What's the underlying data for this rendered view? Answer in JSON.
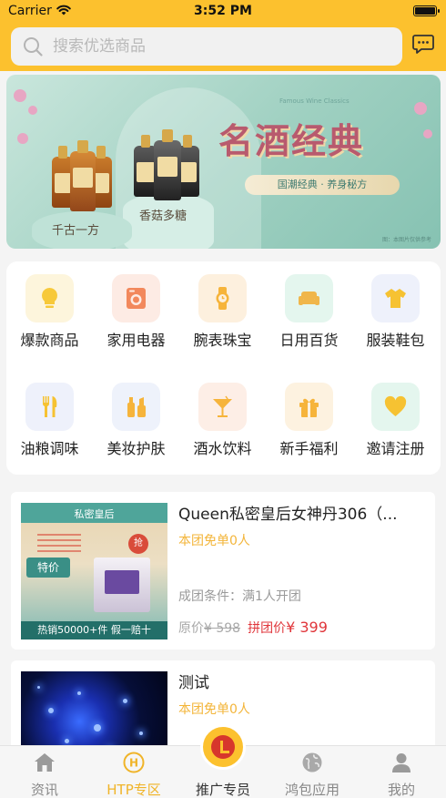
{
  "status_bar": {
    "carrier": "Carrier",
    "time": "3:52 PM"
  },
  "search": {
    "placeholder": "搜索优选商品"
  },
  "banner": {
    "title": "名酒经典",
    "subtitle": "国潮经典 · 养身秘方",
    "english": "Famous Wine Classics",
    "label_left": "千古一方",
    "label_right": "香菇多糖",
    "note": "图：本图片仅供参考"
  },
  "categories": [
    {
      "label": "爆款商品",
      "icon": "lightbulb-icon",
      "bg": "#fdf5dc",
      "color": "#f7c93a"
    },
    {
      "label": "家用电器",
      "icon": "washing-machine-icon",
      "bg": "#fdebe4",
      "color": "#f2885c"
    },
    {
      "label": "腕表珠宝",
      "icon": "watch-icon",
      "bg": "#fdf0de",
      "color": "#f6b43b"
    },
    {
      "label": "日用百货",
      "icon": "sofa-icon",
      "bg": "#e4f6ee",
      "color": "#f0b64a"
    },
    {
      "label": "服装鞋包",
      "icon": "shirt-icon",
      "bg": "#eef1fb",
      "color": "#f6c232"
    },
    {
      "label": "油粮调味",
      "icon": "fork-knife-icon",
      "bg": "#eef1fb",
      "color": "#f6c232"
    },
    {
      "label": "美妆护肤",
      "icon": "cosmetics-icon",
      "bg": "#eef2fb",
      "color": "#f6b43b"
    },
    {
      "label": "酒水饮料",
      "icon": "cocktail-icon",
      "bg": "#fdeee6",
      "color": "#f6b43b"
    },
    {
      "label": "新手福利",
      "icon": "gift-icon",
      "bg": "#fdf2e0",
      "color": "#f6b43b"
    },
    {
      "label": "邀请注册",
      "icon": "heart-icon",
      "bg": "#e4f6ee",
      "color": "#f6c232"
    }
  ],
  "products": [
    {
      "title": "Queen私密皇后女神丹306（...",
      "free": "本团免单0人",
      "condition": "成团条件：满1人开团",
      "orig_label": "原价",
      "orig_price": "¥ 598",
      "group_label": "拼团价",
      "group_price": "¥ 399",
      "thumb": {
        "top": "私密皇后",
        "badge": "特价",
        "seal": "抢",
        "foot": "热销50000+件 假一赔十"
      }
    },
    {
      "title": "测试",
      "free": "本团免单0人"
    }
  ],
  "tabs": [
    {
      "label": "资讯",
      "icon": "home-icon"
    },
    {
      "label": "HTP专区",
      "icon": "htp-zone-icon",
      "active": true
    },
    {
      "label": "推广专员",
      "icon": "promoter-icon"
    },
    {
      "label": "鸿包应用",
      "icon": "globe-icon"
    },
    {
      "label": "我的",
      "icon": "user-icon"
    }
  ],
  "colors": {
    "brand": "#fcc12e",
    "price_red": "#e0363b",
    "accent_orange": "#f3b53a"
  }
}
